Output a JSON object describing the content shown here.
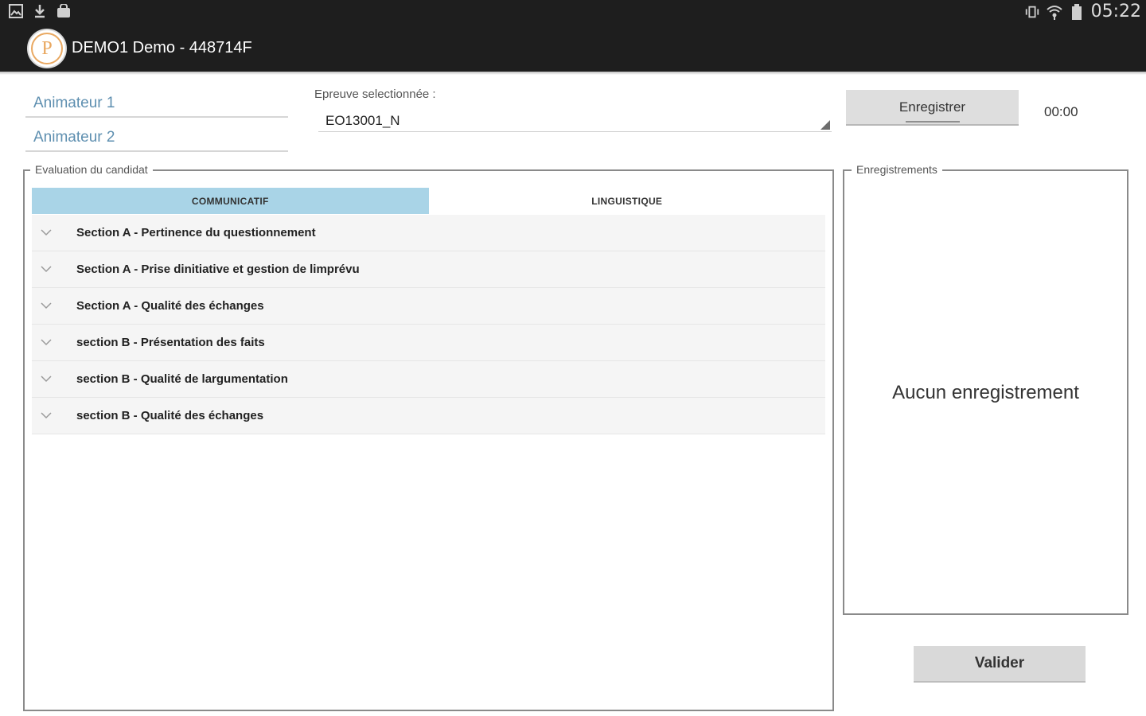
{
  "status_bar": {
    "icons_left": [
      "image-icon",
      "download-icon",
      "bag-icon"
    ],
    "icons_right": [
      "vibrate-icon",
      "wifi-icon",
      "battery-icon"
    ],
    "time": "05:22"
  },
  "action_bar": {
    "logo_letter": "P",
    "title": "DEMO1 Demo - 448714F"
  },
  "animateurs": {
    "field1_placeholder": "Animateur 1",
    "field2_placeholder": "Animateur 2"
  },
  "epreuve": {
    "label": "Epreuve selectionnée :",
    "value": "EO13001_N"
  },
  "recording": {
    "button_label": "Enregistrer",
    "timer": "00:00"
  },
  "evaluation": {
    "legend": "Evaluation du candidat",
    "tabs": [
      {
        "label": "COMMUNICATIF",
        "active": true
      },
      {
        "label": "LINGUISTIQUE",
        "active": false
      }
    ],
    "sections": [
      "Section A - Pertinence du questionnement",
      "Section A - Prise dinitiative et gestion de limprévu",
      "Section A - Qualité des échanges",
      "section B - Présentation des faits",
      "section B - Qualité de largumentation",
      "section B - Qualité des échanges"
    ]
  },
  "enregistrements": {
    "legend": "Enregistrements",
    "empty_text": "Aucun enregistrement"
  },
  "validate_label": "Valider",
  "colors": {
    "bar_background": "#1e1e1e",
    "active_tab": "#a9d4e7",
    "field_text": "#4a83a8"
  }
}
